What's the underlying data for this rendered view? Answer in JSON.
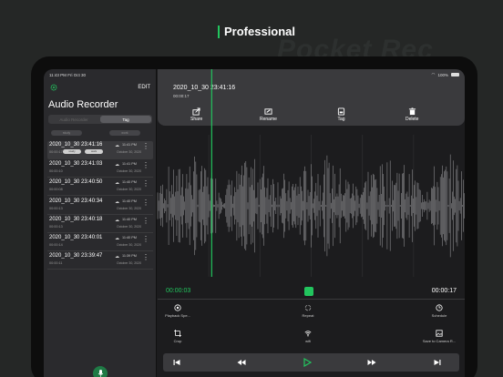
{
  "headline": "Professional",
  "background_word": "Pocket Rec",
  "status": {
    "time": "11:43 PM",
    "date": "Fri Oct 30",
    "battery": "100%"
  },
  "sidebar": {
    "edit_label": "EDIT",
    "title": "Audio Recorder",
    "segments": [
      {
        "label": "Audio Recorder",
        "active": false
      },
      {
        "label": "Tag",
        "active": true
      }
    ],
    "chips": [
      "study",
      "work"
    ]
  },
  "recordings": [
    {
      "name": "2020_10_30 23:41:16",
      "duration": "00:00:17",
      "time": "11:41 PM",
      "date": "October 30, 2020",
      "tags": [
        "study",
        "work"
      ],
      "selected": true
    },
    {
      "name": "2020_10_30 23:41:03",
      "duration": "00:00:10",
      "time": "11:41 PM",
      "date": "October 30, 2020"
    },
    {
      "name": "2020_10_30 23:40:50",
      "duration": "00:00:08",
      "time": "11:40 PM",
      "date": "October 30, 2020"
    },
    {
      "name": "2020_10_30 23:40:34",
      "duration": "00:00:13",
      "time": "11:40 PM",
      "date": "October 30, 2020"
    },
    {
      "name": "2020_10_30 23:40:18",
      "duration": "00:00:13",
      "time": "11:40 PM",
      "date": "October 30, 2020"
    },
    {
      "name": "2020_10_30 23:40:01",
      "duration": "00:00:14",
      "time": "11:40 PM",
      "date": "October 30, 2020"
    },
    {
      "name": "2020_10_30 23:39:47",
      "duration": "00:00:11",
      "time": "11:39 PM",
      "date": "October 30, 2020"
    }
  ],
  "detail": {
    "title": "2020_10_30 23:41:16",
    "duration": "00:00:17",
    "actions": {
      "share": "Share",
      "rename": "Rename",
      "tag": "Tag",
      "delete": "Delete"
    },
    "current_time": "00:00:03",
    "total_time": "00:00:17",
    "playhead_fraction": 0.176,
    "tools": {
      "playback_speed": "Playback Spe...",
      "repeat": "Repeat",
      "schedule": "Schedule",
      "crop": "Crop",
      "wifi": "wifi",
      "save_to_camera_roll": "Save to Camera R..."
    }
  },
  "colors": {
    "accent": "#22c55e",
    "panel": "#3a3a3d",
    "background": "#1c1c1e"
  }
}
